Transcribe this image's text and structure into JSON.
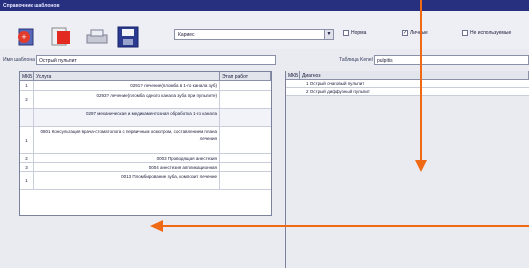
{
  "window": {
    "title": "Справочник шаблонов"
  },
  "toolbar": {
    "combo_value": "Кариес",
    "checks": [
      {
        "label": "Норма",
        "checked": false
      },
      {
        "label": "Личные",
        "checked": true
      },
      {
        "label": "Не используемые",
        "checked": false
      }
    ]
  },
  "form": {
    "template_label": "Имя шаблона",
    "template_value": "Острый пульпит",
    "table_label": "Таблица Kenel",
    "table_value": "pulpitis"
  },
  "left_grid": {
    "headers": [
      "МКБ",
      "Услуга",
      "Этап работ"
    ],
    "rows": [
      {
        "num": "1",
        "text": "0291? лечение(пломба в 1-го канала зуб)"
      },
      {
        "num": "2",
        "text": "0293? лечение(пломба одного канала зуба при пульпите)"
      },
      {
        "num": "",
        "text": "0297 механическая и медикаментозная обработка 1-го канала"
      },
      {
        "num": "1",
        "text": "0801 Консультация врача-стоматолога с первичным осмотром, составлением плана лечения"
      },
      {
        "num": "2",
        "text": "0003 Проводящая анестезия"
      },
      {
        "num": "3",
        "text": "0004 анестезия аппликационная"
      },
      {
        "num": "1",
        "text": "0013 Пломбирование зуба, композит лечение"
      }
    ]
  },
  "right_grid": {
    "headers": [
      "МКБ",
      "Диагноз"
    ],
    "rows": [
      {
        "text": "1 Острый очаговый пульпит"
      },
      {
        "text": "2 Острый диффузный пульпит"
      }
    ]
  },
  "colors": {
    "title_bar": "#27307e",
    "annotation_arrow": "#f06a16"
  }
}
